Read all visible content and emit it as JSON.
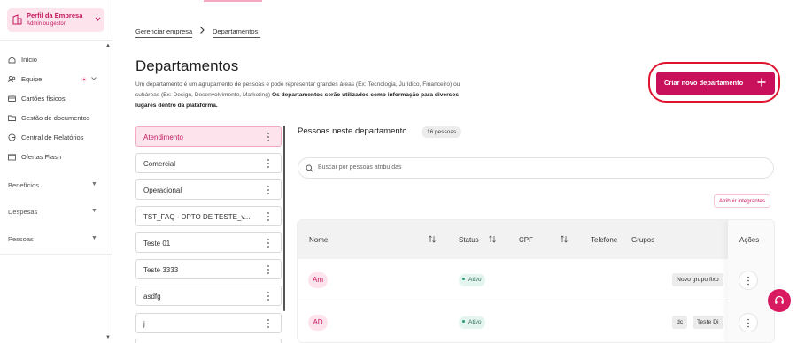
{
  "sidebar": {
    "profile": {
      "title": "Perfil da Empresa",
      "subtitle": "Admin ou gestor"
    },
    "items": [
      {
        "label": "Início",
        "icon": "home-icon"
      },
      {
        "label": "Equipe",
        "icon": "team-icon"
      },
      {
        "label": "Cartões físicos",
        "icon": "card-icon"
      },
      {
        "label": "Gestão de documentos",
        "icon": "folder-icon"
      },
      {
        "label": "Central de Relatórios",
        "icon": "report-icon"
      },
      {
        "label": "Ofertas Flash",
        "icon": "offer-icon"
      }
    ],
    "sections": [
      {
        "label": "Benefícios"
      },
      {
        "label": "Despesas"
      },
      {
        "label": "Pessoas"
      }
    ]
  },
  "breadcrumb": {
    "parent": "Gerenciar empresa",
    "current": "Departamentos"
  },
  "page": {
    "title": "Departamentos",
    "description": "Um departamento é um agrupamento de pessoas e pode representar grandes áreas (Ex: Tecnologia, Jurídico, Financeiro) ou subáreas (Ex: Design, Desenvolvimento, Marketing)",
    "description_bold": "Os departamentos serão utilizados como informação para diversos lugares dentro da plataforma."
  },
  "create_button": {
    "label": "Criar novo departamento"
  },
  "departments": [
    {
      "label": "Atendimento",
      "active": true
    },
    {
      "label": "Comercial"
    },
    {
      "label": "Operacional"
    },
    {
      "label": "TST_FAQ - DPTO DE TESTE_v..."
    },
    {
      "label": "Teste 01"
    },
    {
      "label": "Teste 3333"
    },
    {
      "label": "asdfg"
    },
    {
      "label": "j"
    }
  ],
  "people_panel": {
    "title": "Pessoas neste departamento",
    "count": "16 pessoas",
    "search_placeholder": "Buscar por pessoas atribuídas",
    "assign_label": "Atribuir integrantes"
  },
  "table": {
    "headers": {
      "name": "Nome",
      "status": "Status",
      "cpf": "CPF",
      "phone": "Telefone",
      "groups": "Grupos",
      "actions": "Ações"
    },
    "rows": [
      {
        "initials": "Am",
        "status": "Ativo",
        "groups": [
          "Novo grupo fixo"
        ]
      },
      {
        "initials": "AD",
        "status": "Ativo",
        "groups": [
          "dc",
          "Teste Di"
        ]
      }
    ]
  },
  "colors": {
    "brand": "#c8115a",
    "brand_light": "#fde4ec",
    "highlight_ring": "#e0132f"
  }
}
